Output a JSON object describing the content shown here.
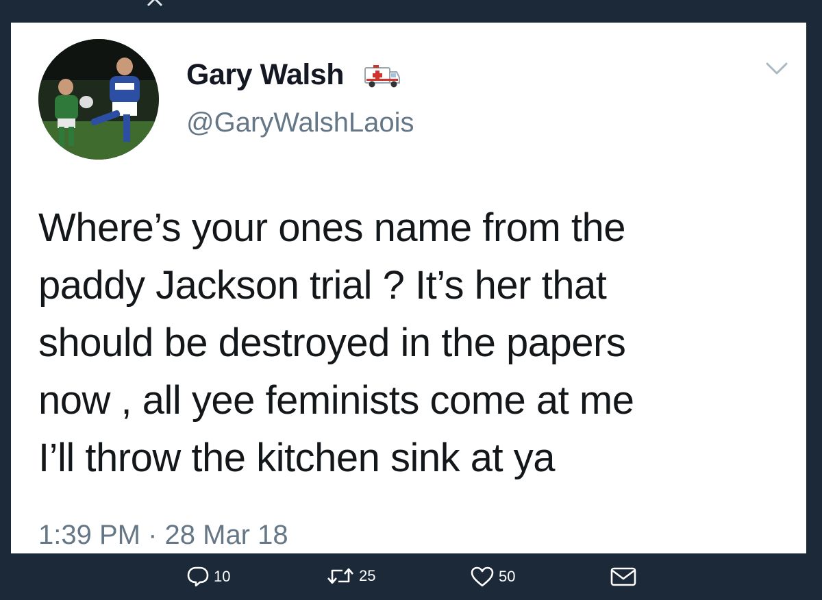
{
  "tweet": {
    "author": {
      "display_name": "Gary Walsh",
      "handle": "@GaryWalshLaois",
      "badge_icon": "ambulance-icon"
    },
    "text_lines": [
      "Where’s your ones name from the",
      "paddy Jackson trial ? It’s her that",
      "should be destroyed in the papers",
      "now , all yee feminists come at me",
      "I’ll throw the kitchen sink at ya"
    ],
    "timestamp": "1:39 PM · 28 Mar 18"
  },
  "actions": {
    "reply": {
      "icon": "reply-icon",
      "count": "10"
    },
    "retweet": {
      "icon": "retweet-icon",
      "count": "25"
    },
    "like": {
      "icon": "heart-icon",
      "count": "50"
    },
    "message": {
      "icon": "envelope-icon"
    }
  },
  "colors": {
    "background": "#1c2938",
    "card": "#ffffff",
    "text": "#14171a",
    "secondary": "#657786"
  }
}
